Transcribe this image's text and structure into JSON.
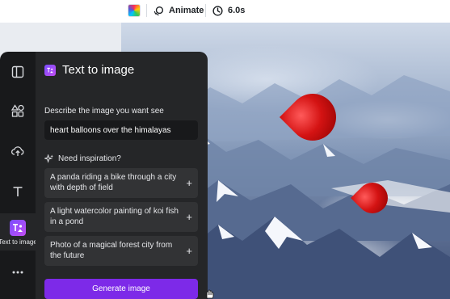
{
  "toolbar": {
    "color_icon": "color-palette-icon",
    "animate_label": "Animate",
    "duration_label": "6.0s"
  },
  "rail": {
    "items": [
      {
        "name": "templates",
        "icon": "layout-icon"
      },
      {
        "name": "elements",
        "icon": "shapes-icon"
      },
      {
        "name": "uploads",
        "icon": "cloud-upload-icon"
      },
      {
        "name": "text",
        "icon": "text-icon"
      },
      {
        "name": "text-to-image",
        "icon": "text-to-image-icon",
        "label": "Text to image",
        "active": true
      },
      {
        "name": "more",
        "icon": "more-icon"
      }
    ]
  },
  "panel": {
    "title": "Text to image",
    "describe_label": "Describe the image you want see",
    "prompt_value": "heart balloons over the himalayas",
    "inspiration_label": "Need inspiration?",
    "suggestions": [
      "A panda riding a bike through a city with depth of field",
      "A light watercolor painting of koi fish in a pond",
      "Photo of a magical forest city from the future"
    ],
    "generate_label": "Generate image"
  },
  "colors": {
    "accent": "#7d2ae8",
    "panel_bg": "#252628",
    "rail_bg": "#18191b"
  }
}
